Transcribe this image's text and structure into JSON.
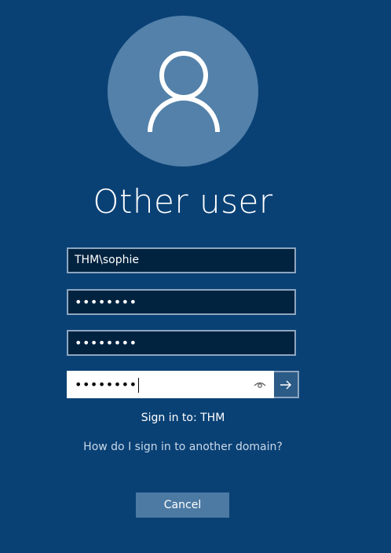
{
  "user": {
    "avatar_icon": "user-icon",
    "title": "Other user"
  },
  "fields": {
    "username_value": "THM\\sophie",
    "password1_value": "••••••••",
    "password2_value": "••••••••",
    "password3_value": "••••••••"
  },
  "icons": {
    "reveal": "eye-icon",
    "submit": "arrow-right-icon"
  },
  "signin_to": "Sign in to: THM",
  "other_domain_link": "How do I sign in to another domain?",
  "cancel_label": "Cancel"
}
